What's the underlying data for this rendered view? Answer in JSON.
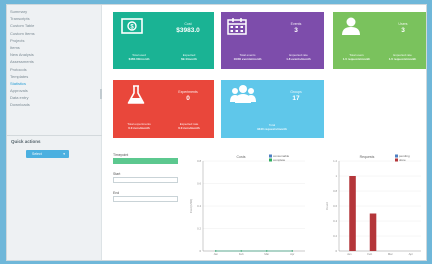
{
  "sidebar": {
    "items": [
      {
        "label": "Summary"
      },
      {
        "label": "Transcripts"
      },
      {
        "label": "Custom Table"
      },
      {
        "label": "Custom Items"
      },
      {
        "label": "Projects"
      },
      {
        "label": "Items"
      },
      {
        "label": "New Analysis"
      },
      {
        "label": "Assessments"
      },
      {
        "label": "Protocols"
      },
      {
        "label": "Templates"
      },
      {
        "label": "Statistics",
        "active": true
      },
      {
        "label": "Approvals"
      },
      {
        "label": "Data entry"
      },
      {
        "label": "Downloads"
      }
    ],
    "quick_actions_title": "Quick actions",
    "quick_button_label": "Select",
    "quick_button_caret": "▾"
  },
  "cards": {
    "budget": {
      "label": "Cost",
      "value": "$3983.0",
      "sub1_label": "Total used",
      "sub1_value": "$480.00/month",
      "sub2_label": "Expected",
      "sub2_value": "$9.4/month",
      "icon": "money-icon",
      "color": "#1ab394"
    },
    "calendar": {
      "label": "Events",
      "value": "3",
      "sub1_label": "Total events",
      "sub1_value": "16/30 events/month",
      "sub2_label": "Expected rate",
      "sub2_value": "1.8 events/month",
      "icon": "calendar-icon",
      "color": "#7d4dab"
    },
    "users": {
      "label": "Users",
      "value": "3",
      "sub1_label": "Total users",
      "sub1_value": "1.0 requests/month",
      "sub2_label": "Expected rate",
      "sub2_value": "1.0 requests/month",
      "icon": "user-icon",
      "color": "#7ac25d"
    },
    "experiments": {
      "label": "Experiments",
      "value": "0",
      "sub1_label": "Total experiments",
      "sub1_value": "0.0 runs/month",
      "sub2_label": "Expected rate",
      "sub2_value": "0.0 runs/month",
      "icon": "flask-icon",
      "color": "#e9473b"
    },
    "groups": {
      "label": "Groups",
      "value": "17",
      "sub1_label": "Total",
      "sub1_value": "3340 requests/month",
      "icon": "group-icon",
      "color": "#5fc7ea"
    }
  },
  "form": {
    "field1_label": "Timepoint",
    "field2_label": "Start",
    "field3_label": "End"
  },
  "chart_data": [
    {
      "type": "line",
      "title": "Costs",
      "ylabel": "Cost (USD)",
      "categories": [
        "Jan",
        "Feb",
        "Mar",
        "Apr"
      ],
      "series": [
        {
          "name": "consumable",
          "color": "#4d7fc2",
          "values": [
            0,
            0,
            0,
            0
          ]
        },
        {
          "name": "complete",
          "color": "#2fae5e",
          "values": [
            0,
            0,
            0,
            0
          ]
        }
      ],
      "yticks": [
        "0.8",
        "0.6",
        "0.4",
        "0.2",
        "0"
      ],
      "ylim": [
        0,
        0.8
      ]
    },
    {
      "type": "bar",
      "title": "Requests",
      "ylabel": "Count",
      "categories": [
        "Jan",
        "Feb",
        "Mar",
        "Apr"
      ],
      "series": [
        {
          "name": "pending",
          "color": "#4d7fc2",
          "values": [
            0,
            0,
            0,
            0
          ]
        },
        {
          "name": "done",
          "color": "#b4363a",
          "values": [
            1,
            0.5,
            0,
            0
          ]
        }
      ],
      "yticks": [
        "1.2",
        "1",
        "0.8",
        "0.6",
        "0.4",
        "0.2",
        "0"
      ],
      "ylim": [
        0,
        1.2
      ]
    }
  ]
}
